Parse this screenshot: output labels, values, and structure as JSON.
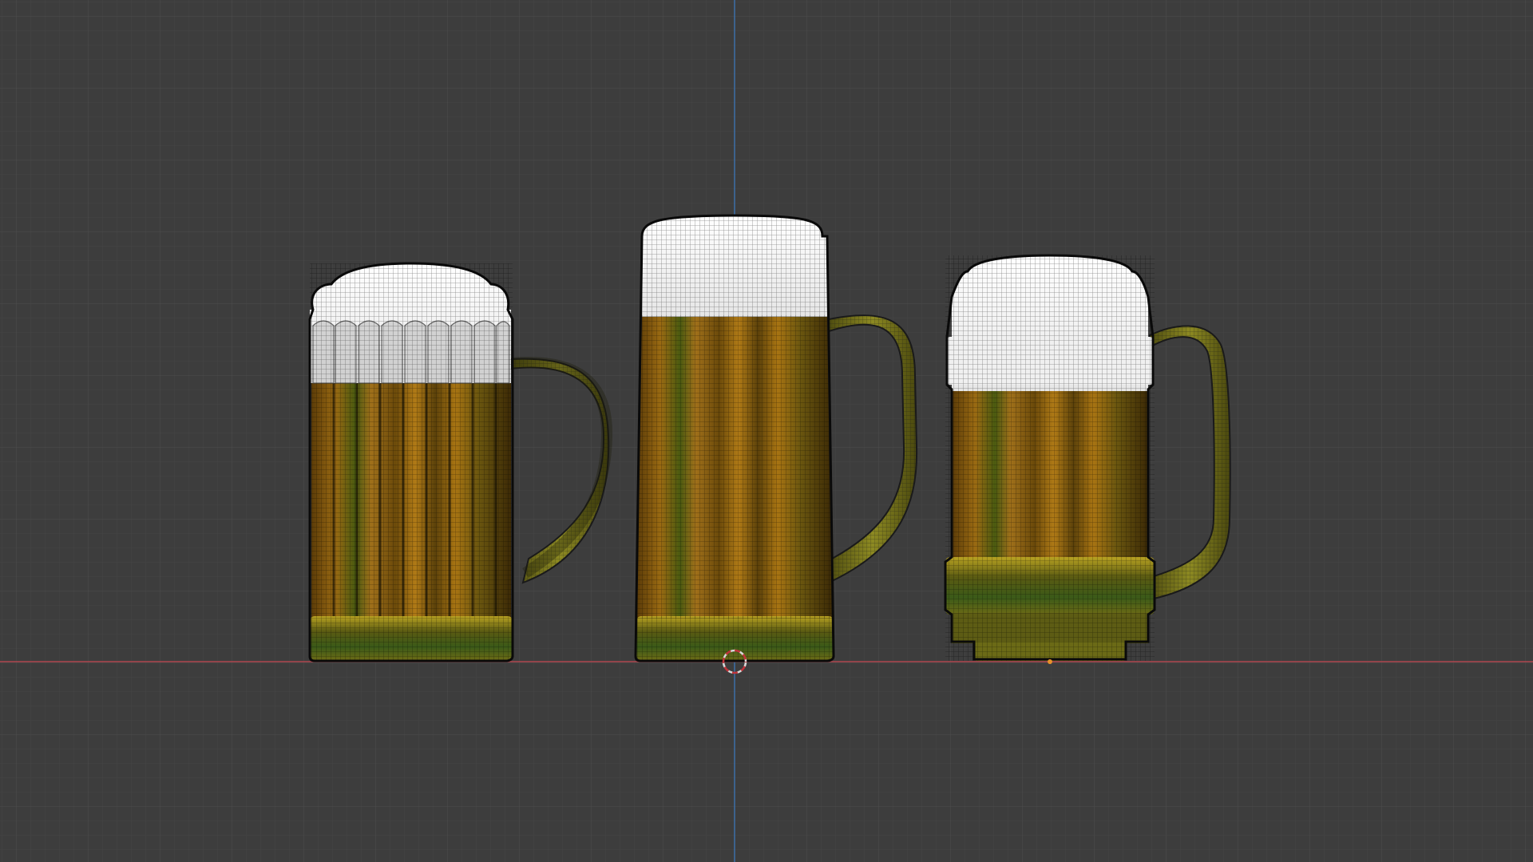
{
  "viewport": {
    "background": "#3d3d3d",
    "grid_minor_color": "#454545",
    "grid_major_color": "#4e4e4e",
    "x_axis_color": "#b0464f",
    "z_axis_color": "#3d6fa8",
    "cursor_colors": [
      "#d8d8d8",
      "#c0343b"
    ],
    "origin_dot_color": "#e8912a"
  },
  "objects": [
    {
      "name": "beer-mug-faceted",
      "style": "faceted",
      "foam_color": "#f2f2f2",
      "beer_color": "#8a5e10",
      "glass_color": "#7c7a18"
    },
    {
      "name": "beer-mug-tall",
      "style": "tall",
      "foam_color": "#f2f2f2",
      "beer_color": "#8f6312",
      "glass_color": "#7c7a18"
    },
    {
      "name": "beer-mug-banded",
      "style": "banded",
      "foam_color": "#f2f2f2",
      "beer_color": "#8a5e10",
      "glass_color": "#7c7a18"
    }
  ]
}
